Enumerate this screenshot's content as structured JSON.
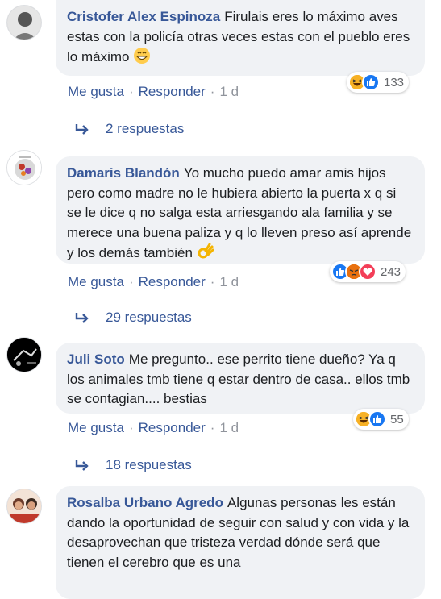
{
  "comments": [
    {
      "author": "Cristofer Alex Espinoza",
      "text": "Firulais eres lo máximo aves estas con la policía otras veces estas con el pueblo eres lo máximo",
      "like_label": "Me gusta",
      "reply_label": "Responder",
      "time": "1 d",
      "reaction_count": "133",
      "reactions": [
        "haha-icon",
        "like-icon"
      ],
      "replies_label": "2 respuestas"
    },
    {
      "author": "Damaris Blandón",
      "text": "Yo mucho puedo amar amis hijos pero como madre no le hubiera abierto la puerta x q si se le dice q no salga esta arriesgando ala familia y se merece una buena paliza y q lo lleven preso así aprende y los demás también",
      "like_label": "Me gusta",
      "reply_label": "Responder",
      "time": "1 d",
      "reaction_count": "243",
      "reactions": [
        "like-icon",
        "angry-icon",
        "love-icon"
      ],
      "replies_label": "29 respuestas"
    },
    {
      "author": "Juli Soto",
      "text": "Me pregunto.. ese perrito tiene dueño? Ya q los animales tmb tiene q estar dentro de casa.. ellos tmb se contagian.... bestias",
      "like_label": "Me gusta",
      "reply_label": "Responder",
      "time": "1 d",
      "reaction_count": "55",
      "reactions": [
        "haha-icon",
        "like-icon"
      ],
      "replies_label": "18 respuestas"
    },
    {
      "author": "Rosalba Urbano Agredo",
      "text": "Algunas personas les están dando la oportunidad de seguir con salud y con vida y la desaprovechan que tristeza verdad dónde será que tienen el cerebro que es una"
    }
  ],
  "separator": "·",
  "colors": {
    "author": "#385898",
    "bubble": "#f0f2f5",
    "like_blue": "#1877f2",
    "love_red": "#f33e58",
    "haha_yellow": "#f7b125"
  }
}
